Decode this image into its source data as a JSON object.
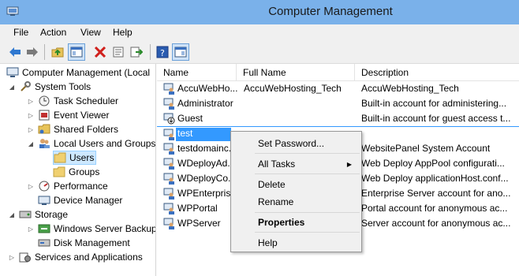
{
  "window": {
    "title": "Computer Management"
  },
  "menu": [
    "File",
    "Action",
    "View",
    "Help"
  ],
  "toolbar": {
    "icons": [
      "back-arrow-icon",
      "forward-arrow-icon",
      "up-folder-icon",
      "show-hide-tree-icon",
      "delete-icon",
      "properties-icon",
      "export-list-icon",
      "help-icon",
      "show-hide-action-pane-icon"
    ]
  },
  "tree": {
    "root": "Computer Management (Local",
    "system_tools": "System Tools",
    "task_scheduler": "Task Scheduler",
    "event_viewer": "Event Viewer",
    "shared_folders": "Shared Folders",
    "local_users": "Local Users and Groups",
    "users": "Users",
    "groups": "Groups",
    "performance": "Performance",
    "device_manager": "Device Manager",
    "storage": "Storage",
    "backup": "Windows Server Backup",
    "disk_mgmt": "Disk Management",
    "services": "Services and Applications"
  },
  "columns": {
    "name": "Name",
    "full_name": "Full Name",
    "description": "Description"
  },
  "users": [
    {
      "name": "AccuWebHo...",
      "full_name": "AccuWebHosting_Tech",
      "description": "AccuWebHosting_Tech"
    },
    {
      "name": "Administrator",
      "full_name": "",
      "description": "Built-in account for administering..."
    },
    {
      "name": "Guest",
      "full_name": "",
      "description": "Built-in account for guest access t..."
    },
    {
      "name": "test",
      "full_name": "",
      "description": ""
    },
    {
      "name": "testdomainc...",
      "full_name": "",
      "description": "WebsitePanel System Account"
    },
    {
      "name": "WDeployAd...",
      "full_name": "",
      "description": "Web Deploy AppPool configurati..."
    },
    {
      "name": "WDeployCo...",
      "full_name": "",
      "description": "Web Deploy applicationHost.conf..."
    },
    {
      "name": "WPEnterpris...",
      "full_name": "",
      "description": "Enterprise Server account for ano..."
    },
    {
      "name": "WPPortal",
      "full_name": "",
      "description": "Portal account for anonymous ac..."
    },
    {
      "name": "WPServer",
      "full_name": "",
      "description": "Server account for anonymous ac..."
    }
  ],
  "context_menu": {
    "set_password": "Set Password...",
    "all_tasks": "All Tasks",
    "delete": "Delete",
    "rename": "Rename",
    "properties": "Properties",
    "help": "Help"
  },
  "colors": {
    "titlebar": "#7ab1ea",
    "selection": "#3399ff",
    "tree_selection": "#cde8ff"
  }
}
